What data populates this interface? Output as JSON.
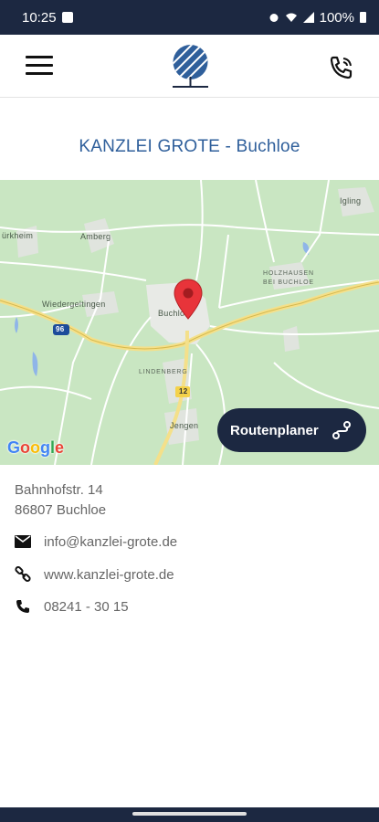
{
  "status_bar": {
    "time": "10:25",
    "battery": "100%",
    "icons": [
      "image-icon",
      "alarm-icon",
      "wifi-icon",
      "signal-icon",
      "battery-icon"
    ]
  },
  "app_bar": {
    "menu_icon": "menu-icon",
    "logo_icon": "tree-logo-icon",
    "call_icon": "phone-call-icon"
  },
  "page": {
    "title": "KANZLEI GROTE - Buchloe"
  },
  "map": {
    "labels": {
      "turkheim": "ürkheim",
      "amberg": "Amberg",
      "igling": "Igling",
      "holzhausen": "HOLZHAUSEN BEI BUCHLOE",
      "wiedergeltingen": "Wiedergeltingen",
      "buchloe": "Buchloe",
      "lindenberg": "LINDENBERG",
      "jengen": "Jengen",
      "road_96": "96",
      "road_12": "12"
    },
    "google_logo": "Google",
    "pin_icon": "location-pin-icon",
    "route_button": {
      "label": "Routenplaner",
      "icon": "route-icon"
    }
  },
  "contact": {
    "address_line1": "Bahnhofstr. 14",
    "address_line2": "86807 Buchloe",
    "email": "info@kanzlei-grote.de",
    "website": "www.kanzlei-grote.de",
    "phone": "08241 - 30 15"
  },
  "colors": {
    "navy": "#1c2841",
    "title_blue": "#2f5f9b",
    "map_green": "#c9e6c2"
  }
}
